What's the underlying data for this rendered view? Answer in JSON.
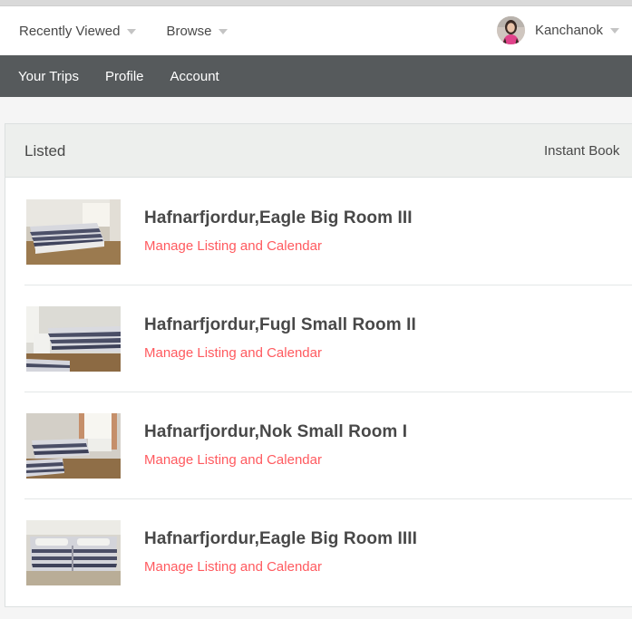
{
  "header": {
    "recently_viewed_label": "Recently Viewed",
    "browse_label": "Browse",
    "user_name": "Kanchanok"
  },
  "subnav": {
    "items": [
      "Your Trips",
      "Profile",
      "Account"
    ]
  },
  "listings_panel": {
    "title": "Listed",
    "instant_book_label": "Instant Book",
    "listings": [
      {
        "title": "Hafnarfjordur,Eagle Big Room III",
        "link": "Manage Listing and Calendar"
      },
      {
        "title": "Hafnarfjordur,Fugl Small Room II",
        "link": "Manage Listing and Calendar"
      },
      {
        "title": "Hafnarfjordur,Nok Small Room I",
        "link": "Manage Listing and Calendar"
      },
      {
        "title": "Hafnarfjordur,Eagle Big Room IIII",
        "link": "Manage Listing and Calendar"
      }
    ]
  },
  "colors": {
    "subnav_bg": "#565a5c",
    "link": "#ff5a5f",
    "panel_head_bg": "#edefed"
  }
}
